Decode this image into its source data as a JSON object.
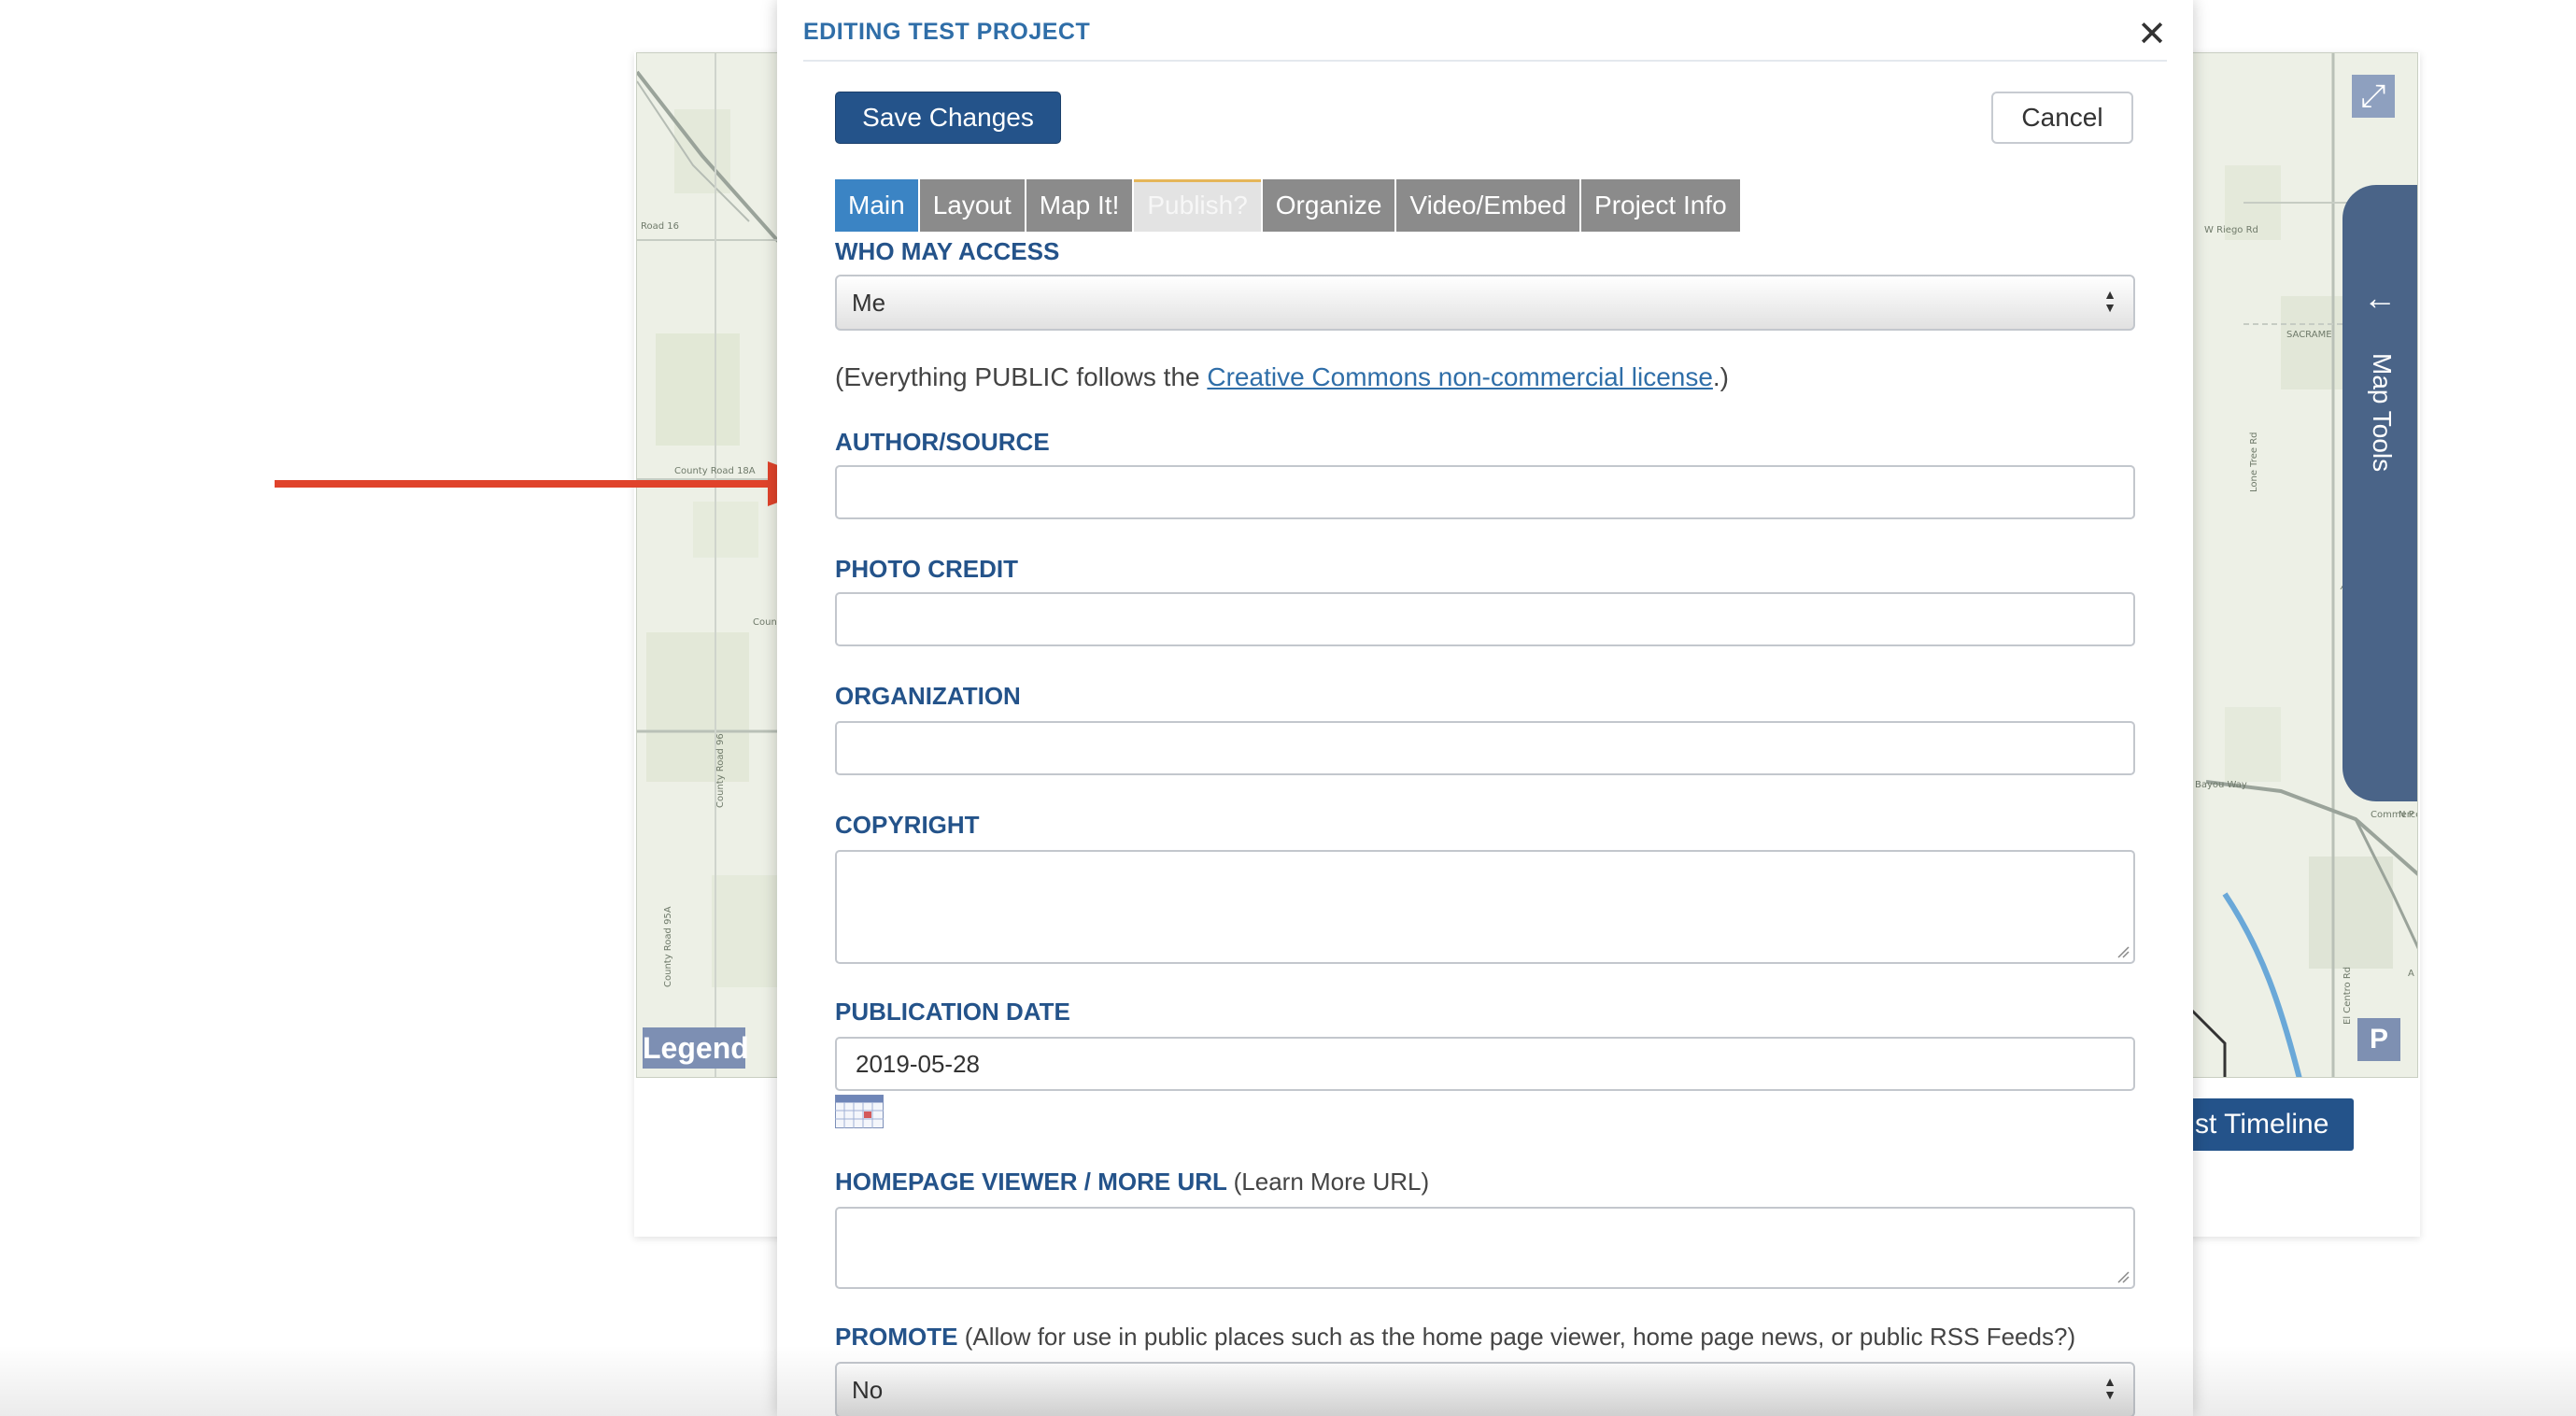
{
  "map": {
    "labels": [
      "Road 16",
      "County Road 18A",
      "County",
      "County Road 96",
      "County Road 95A",
      "W Riego Rd",
      "SACRAME",
      "Lone Tree Rd",
      "AM",
      "Bayou Way",
      "Commerce Way",
      "N P",
      "El Centro Rd",
      "A"
    ],
    "legend_label": "Legend",
    "expand_icon": "expand-icon",
    "parking_label": "P",
    "map_tools_label": "Map Tools",
    "map_tools_icon": "arrow-left-icon",
    "timeline_label": "st Timeline"
  },
  "modal": {
    "title": "EDITING TEST PROJECT",
    "close_icon": "close-icon",
    "save_label": "Save Changes",
    "cancel_label": "Cancel",
    "tabs": [
      {
        "label": "Main",
        "state": "active"
      },
      {
        "label": "Layout",
        "state": "normal"
      },
      {
        "label": "Map It!",
        "state": "normal"
      },
      {
        "label": "Publish?",
        "state": "disabled"
      },
      {
        "label": "Organize",
        "state": "normal"
      },
      {
        "label": "Video/Embed",
        "state": "normal"
      },
      {
        "label": "Project Info",
        "state": "normal"
      }
    ],
    "who_may_access": {
      "label": "WHO MAY ACCESS",
      "value": "Me"
    },
    "license": {
      "prefix": "(Everything PUBLIC follows the ",
      "link": "Creative Commons non-commercial license",
      "suffix": ".)"
    },
    "author_source": {
      "label": "AUTHOR/SOURCE",
      "value": ""
    },
    "photo_credit": {
      "label": "PHOTO CREDIT",
      "value": ""
    },
    "organization": {
      "label": "ORGANIZATION",
      "value": ""
    },
    "copyright": {
      "label": "COPYRIGHT",
      "value": ""
    },
    "publication_date": {
      "label": "PUBLICATION DATE",
      "value": "2019-05-28",
      "calendar_icon": "calendar-icon"
    },
    "homepage_viewer": {
      "label": "HOMEPAGE VIEWER / MORE URL",
      "note": "(Learn More URL)",
      "value": ""
    },
    "promote": {
      "label": "PROMOTE",
      "note": "(Allow for use in public places such as the home page viewer, home page news, or public RSS Feeds?)",
      "value": "No"
    }
  },
  "colors": {
    "accent": "#24538a",
    "label_blue": "#2f6ea8",
    "tab_active": "#3b84c4",
    "tab_inactive": "#8b8b8b",
    "annotation_arrow": "#e0432b",
    "map_tools": "#4a6488"
  }
}
